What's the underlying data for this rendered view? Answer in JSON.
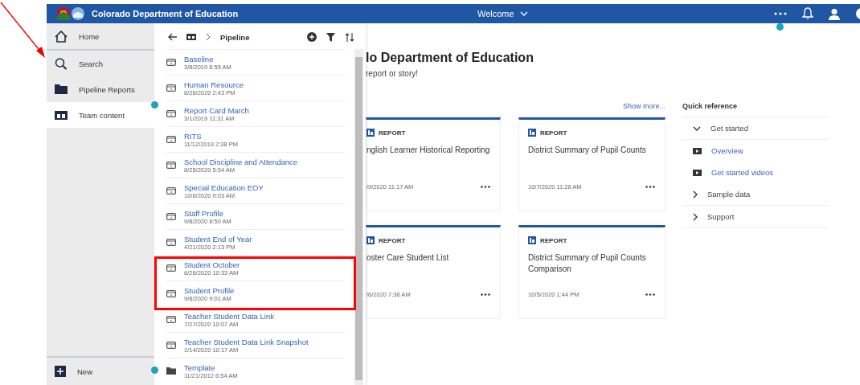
{
  "header": {
    "title": "Colorado Department of Education",
    "menu_label": "Welcome"
  },
  "sidebar": {
    "items": [
      {
        "label": "Home",
        "kind": "home",
        "selected": false
      },
      {
        "label": "Search",
        "kind": "search",
        "selected": false
      },
      {
        "label": "Pipeline Reports",
        "kind": "folder",
        "selected": false
      },
      {
        "label": "Team content",
        "kind": "team",
        "selected": true
      }
    ],
    "new_label": "New"
  },
  "panel": {
    "breadcrumb": "Pipeline",
    "items": [
      {
        "name": "Baseline",
        "date": "3/8/2019 8:55 AM",
        "kind": "report"
      },
      {
        "name": "Human Resource",
        "date": "8/26/2020 2:43 PM",
        "kind": "report"
      },
      {
        "name": "Report Card March",
        "date": "3/1/2019 11:31 AM",
        "kind": "report"
      },
      {
        "name": "RITS",
        "date": "11/12/2019 2:38 PM",
        "kind": "report"
      },
      {
        "name": "School Discipline and Attendance",
        "date": "8/25/2020 5:54 AM",
        "kind": "report"
      },
      {
        "name": "Special Education EOY",
        "date": "10/6/2020 9:03 AM",
        "kind": "report"
      },
      {
        "name": "Staff Profile",
        "date": "9/8/2020 8:50 AM",
        "kind": "report"
      },
      {
        "name": "Student End of Year",
        "date": "4/21/2020 2:13 PM",
        "kind": "report"
      },
      {
        "name": "Student October",
        "date": "8/26/2020 10:33 AM",
        "kind": "report"
      },
      {
        "name": "Student Profile",
        "date": "9/8/2020 9:01 AM",
        "kind": "report"
      },
      {
        "name": "Teacher Student Data Link",
        "date": "7/27/2020 10:07 AM",
        "kind": "report"
      },
      {
        "name": "Teacher Student Data Link Snapshot",
        "date": "1/14/2020 10:17 AM",
        "kind": "report"
      },
      {
        "name": "Template",
        "date": "11/21/2012 6:54 AM",
        "kind": "folder"
      }
    ]
  },
  "main": {
    "title": "lo Department of Education",
    "subtitle": "report or story!",
    "show_more": "Show more...",
    "cards": [
      {
        "type_label": "REPORT",
        "title": "nglish Learner Historical Reporting",
        "date": "/9/2020 11:17 AM"
      },
      {
        "type_label": "REPORT",
        "title": "District Summary of Pupil Counts",
        "date": "10/7/2020 11:28 AM"
      },
      {
        "type_label": "REPORT",
        "title": "oster Care Student List",
        "date": "/6/2020 7:36 AM"
      },
      {
        "type_label": "REPORT",
        "title": "District Summary of Pupil Counts Comparison",
        "date": "10/5/2020 1:44 PM"
      }
    ],
    "quick_reference": {
      "title": "Quick reference",
      "items": [
        {
          "label": "Get started",
          "kind": "group",
          "expanded": true
        },
        {
          "label": "Overview",
          "kind": "video"
        },
        {
          "label": "Get started videos",
          "kind": "video"
        },
        {
          "label": "Sample data",
          "kind": "group",
          "expanded": false
        },
        {
          "label": "Support",
          "kind": "group",
          "expanded": false
        }
      ]
    }
  }
}
